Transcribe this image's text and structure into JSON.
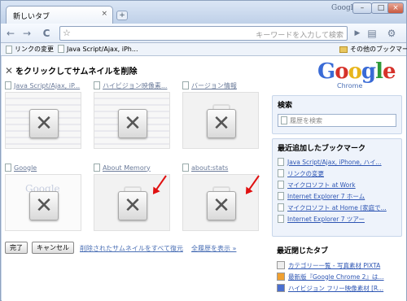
{
  "titlebar": {
    "tab_title": "新しいタブ",
    "tab_close": "×",
    "new_tab": "+",
    "google_label": "Google",
    "win_minimize": "–",
    "win_maximize": "□",
    "win_close": "×"
  },
  "toolbar": {
    "back": "←",
    "forward": "→",
    "reload": "C",
    "star": "☆",
    "omnibox_placeholder": "キーワードを入力して検索",
    "go": "▶",
    "page_menu": "▤",
    "tools_menu": "⚙"
  },
  "bookmarks_bar": {
    "items": [
      "リンクの変更",
      "Java Script/Ajax, iPh..."
    ],
    "other": "その他のブックマーク"
  },
  "editing": {
    "header": "をクリックしてサムネイルを削除",
    "close_glyph": "✕"
  },
  "thumbnails": [
    {
      "title": "Java Script/Ajax, iP..."
    },
    {
      "title": "ハイビジョン映像素..."
    },
    {
      "title": "バージョン情報"
    },
    {
      "title": "Google"
    },
    {
      "title": "About Memory"
    },
    {
      "title": "about:stats"
    }
  ],
  "remove_glyph": "✕",
  "actions": {
    "done": "完了",
    "cancel": "キャンセル",
    "restore_all": "削除されたサムネイルをすべて復元",
    "show_history": "全履歴を表示 »"
  },
  "sidebar": {
    "logo_letters": [
      "G",
      "o",
      "o",
      "g",
      "l",
      "e"
    ],
    "logo_sub": "Chrome",
    "search": {
      "title": "検索",
      "placeholder": "履歴を検索"
    },
    "recent_bookmarks": {
      "title": "最近追加したブックマーク",
      "items": [
        "Java Script/Ajax, iPhone, ハイ...",
        "リンクの変更",
        "マイクロソフト at Work",
        "Internet Explorer 7 ホーム",
        "マイクロソフト at Home (家庭で...",
        "Internet Explorer 7 ツアー"
      ]
    },
    "recently_closed": {
      "title": "最近閉じたタブ",
      "items": [
        "カテゴリー一覧 - 写真素材 PIXTA",
        "最新版『Google Chrome 2』は...",
        "ハイビジョン フリー映像素材 [R..."
      ]
    }
  },
  "colors": {
    "logo": [
      "#3a6bd6",
      "#d6322a",
      "#e8b51c",
      "#3a6bd6",
      "#2f9a3a",
      "#d6322a"
    ],
    "accent_link": "#2d55b3",
    "arrow": "#e01010"
  }
}
